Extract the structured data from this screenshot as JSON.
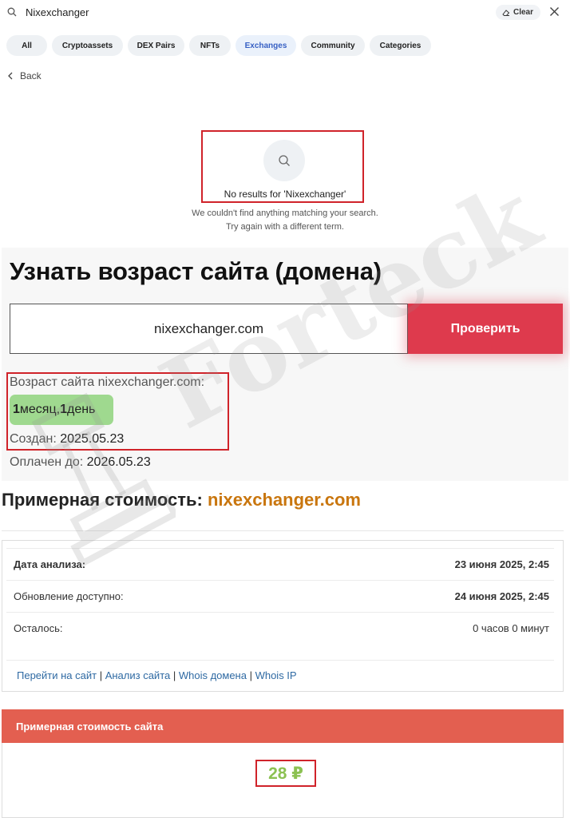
{
  "search": {
    "query": "Nixexchanger",
    "clear_label": "Clear"
  },
  "tabs": [
    {
      "label": "All",
      "active": false
    },
    {
      "label": "Cryptoassets",
      "active": false
    },
    {
      "label": "DEX Pairs",
      "active": false
    },
    {
      "label": "NFTs",
      "active": false
    },
    {
      "label": "Exchanges",
      "active": true
    },
    {
      "label": "Community",
      "active": false
    },
    {
      "label": "Categories",
      "active": false
    }
  ],
  "nav": {
    "back_label": "Back"
  },
  "empty_state": {
    "title": "No results for 'Nixexchanger'",
    "line1": "We couldn't find anything matching your search.",
    "line2": "Try again with a different term."
  },
  "age_tool": {
    "title": "Узнать возраст сайта (домена)",
    "input_value": "nixexchanger.com",
    "button_label": "Проверить",
    "age_label": "Возраст сайта nixexchanger.com:",
    "age_num1": "1",
    "age_unit1": " месяц, ",
    "age_num2": "1",
    "age_unit2": " день",
    "created_label": "Создан: ",
    "created_value": "2025.05.23",
    "paid_label": "Оплачен до: ",
    "paid_value": "2026.05.23"
  },
  "cost": {
    "heading_prefix": "Примерная стоимость: ",
    "heading_domain": "nixexchanger.com",
    "rows": [
      {
        "key": "Дата анализа:",
        "value": "23 июня 2025, 2:45"
      },
      {
        "key": "Обновление доступно:",
        "value": "24 июня 2025, 2:45"
      },
      {
        "key": "Осталось:",
        "value": "0 часов 0 минут"
      }
    ],
    "links": [
      "Перейти на сайт",
      "Анализ сайта",
      "Whois домена",
      "Whois IP"
    ],
    "link_separator": " | ",
    "price_header": "Примерная стоимость сайта",
    "price_value": "28 ₽"
  },
  "watermark": {
    "text": "Forteck"
  },
  "colors": {
    "accent_red": "#de3a4d",
    "header_red": "#e35f50",
    "domain_orange": "#c9760e",
    "price_green": "#8cc152",
    "badge_green": "#9fd98f",
    "active_tab_blue": "#3861c4"
  }
}
